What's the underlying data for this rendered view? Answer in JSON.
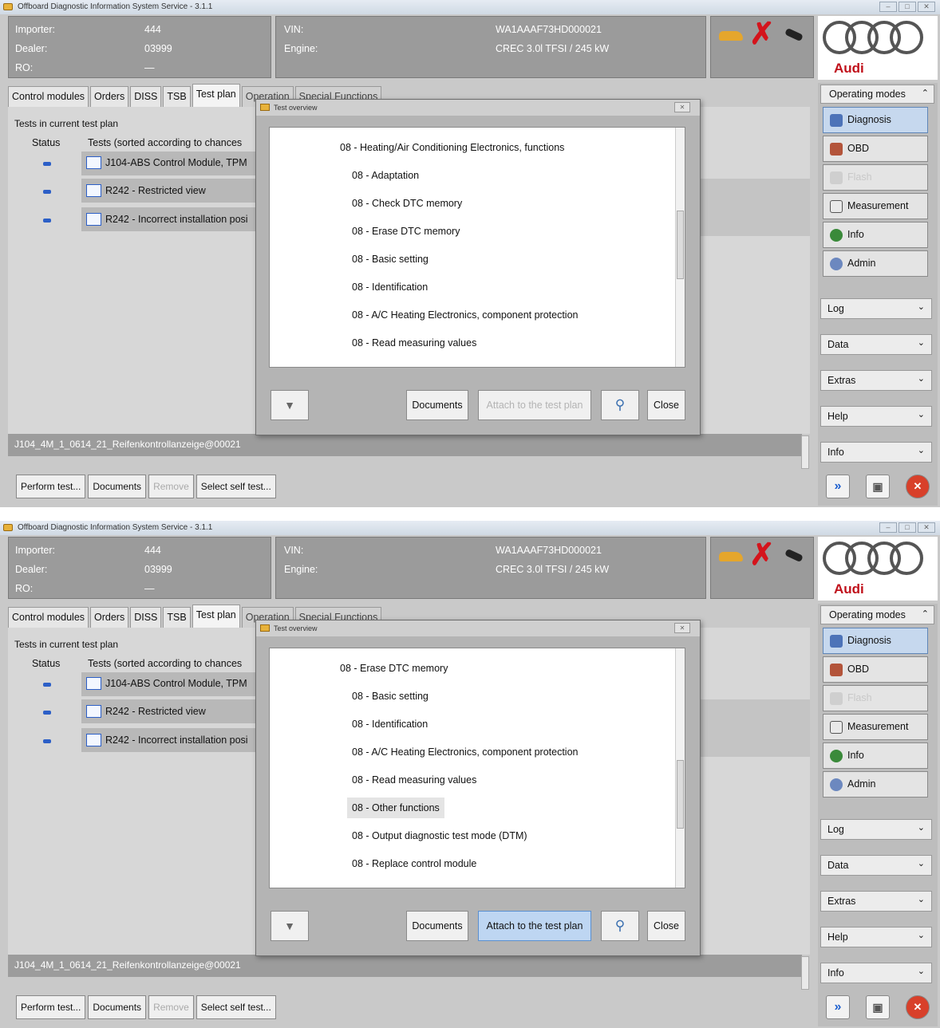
{
  "screens": [
    {
      "window_title": "Offboard Diagnostic Information System Service - 3.1.1",
      "vehicle": {
        "importer_label": "Importer:",
        "importer": "444",
        "dealer_label": "Dealer:",
        "dealer": "03999",
        "ro_label": "RO:",
        "ro": "—",
        "vin_label": "VIN:",
        "vin": "WA1AAAF73HD000021",
        "engine_label": "Engine:",
        "engine": "CREC 3.0l TFSI / 245 kW"
      },
      "brand": "Audi",
      "tabs": [
        "Control modules",
        "Orders",
        "DISS",
        "TSB",
        "Test plan",
        "Operation",
        "Special Functions"
      ],
      "plan": {
        "section_title": "Tests in current test plan",
        "col_status": "Status",
        "col_tests": "Tests (sorted according to chances",
        "rows": [
          "J104-ABS Control Module, TPM",
          "R242 - Restricted view",
          "R242 - Incorrect installation posi"
        ]
      },
      "path": "J104_4M_1_0614_21_Reifenkontrollanzeige@00021",
      "bottom_buttons": [
        "Perform test...",
        "Documents",
        "Remove",
        "Select self test..."
      ],
      "side": {
        "header": "Operating modes",
        "modes": [
          "Diagnosis",
          "OBD",
          "Flash",
          "Measurement",
          "Info",
          "Admin"
        ],
        "menus": [
          "Log",
          "Data",
          "Extras",
          "Help",
          "Info"
        ]
      },
      "dialog": {
        "title": "Test overview",
        "items": [
          "08 - Heating/Air Conditioning Electronics, functions",
          "08 - Adaptation",
          "08 - Check DTC memory",
          "08 - Erase DTC memory",
          "08 - Basic setting",
          "08 - Identification",
          "08 - A/C Heating Electronics, component protection",
          "08 - Read measuring values"
        ],
        "selected_item": "",
        "buttons": {
          "documents": "Documents",
          "attach": "Attach to the test plan",
          "close": "Close"
        },
        "attach_enabled": false
      }
    },
    {
      "window_title": "Offboard Diagnostic Information System Service - 3.1.1",
      "vehicle": {
        "importer_label": "Importer:",
        "importer": "444",
        "dealer_label": "Dealer:",
        "dealer": "03999",
        "ro_label": "RO:",
        "ro": "—",
        "vin_label": "VIN:",
        "vin": "WA1AAAF73HD000021",
        "engine_label": "Engine:",
        "engine": "CREC 3.0l TFSI / 245 kW"
      },
      "brand": "Audi",
      "tabs": [
        "Control modules",
        "Orders",
        "DISS",
        "TSB",
        "Test plan",
        "Operation",
        "Special Functions"
      ],
      "plan": {
        "section_title": "Tests in current test plan",
        "col_status": "Status",
        "col_tests": "Tests (sorted according to chances",
        "rows": [
          "J104-ABS Control Module, TPM",
          "R242 - Restricted view",
          "R242 - Incorrect installation posi"
        ]
      },
      "path": "J104_4M_1_0614_21_Reifenkontrollanzeige@00021",
      "bottom_buttons": [
        "Perform test...",
        "Documents",
        "Remove",
        "Select self test..."
      ],
      "side": {
        "header": "Operating modes",
        "modes": [
          "Diagnosis",
          "OBD",
          "Flash",
          "Measurement",
          "Info",
          "Admin"
        ],
        "menus": [
          "Log",
          "Data",
          "Extras",
          "Help",
          "Info"
        ]
      },
      "dialog": {
        "title": "Test overview",
        "items": [
          "08 - Erase DTC memory",
          "08 - Basic setting",
          "08 - Identification",
          "08 - A/C Heating Electronics, component protection",
          "08 - Read measuring values",
          "08 - Other functions",
          "08 - Output diagnostic test mode (DTM)",
          "08 - Replace control module"
        ],
        "selected_item": "08 - Other functions",
        "buttons": {
          "documents": "Documents",
          "attach": "Attach to the test plan",
          "close": "Close"
        },
        "attach_enabled": true
      }
    }
  ]
}
